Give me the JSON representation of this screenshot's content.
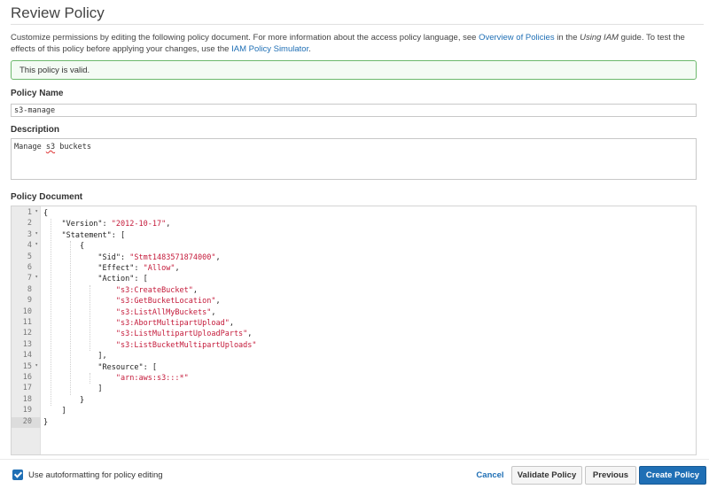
{
  "page": {
    "title": "Review Policy",
    "intro_1": "Customize permissions by editing the following policy document. For more information about the access policy language, see ",
    "intro_link_1": "Overview of Policies",
    "intro_2": " in the ",
    "intro_italic": "Using IAM",
    "intro_3": " guide. To test the effects of this policy before applying your changes, use the ",
    "intro_link_2": "IAM Policy Simulator",
    "intro_4": "."
  },
  "validation": {
    "message": "This policy is valid.",
    "color": "#6cb86c"
  },
  "policy_name": {
    "label": "Policy Name",
    "value": "s3-manage"
  },
  "description": {
    "label": "Description",
    "value_1": "Manage ",
    "value_misspelled": "s3",
    "value_2": " buckets"
  },
  "policy_document": {
    "label": "Policy Document",
    "line_numbers": [
      "1",
      "2",
      "3",
      "4",
      "5",
      "6",
      "7",
      "8",
      "9",
      "10",
      "11",
      "12",
      "13",
      "14",
      "15",
      "16",
      "17",
      "18",
      "19",
      "20"
    ],
    "lines": [
      "{",
      "    \"Version\": \"2012-10-17\",",
      "    \"Statement\": [",
      "        {",
      "            \"Sid\": \"Stmt1483571874000\",",
      "            \"Effect\": \"Allow\",",
      "            \"Action\": [",
      "                \"s3:CreateBucket\",",
      "                \"s3:GetBucketLocation\",",
      "                \"s3:ListAllMyBuckets\",",
      "                \"s3:AbortMultipartUpload\",",
      "                \"s3:ListMultipartUploadParts\",",
      "                \"s3:ListBucketMultipartUploads\"",
      "            ],",
      "            \"Resource\": [",
      "                \"arn:aws:s3:::*\"",
      "            ]",
      "        }",
      "    ]",
      "}"
    ],
    "fold_markers": [
      "1",
      "3",
      "4",
      "7",
      "15"
    ],
    "active_line": "20"
  },
  "footer": {
    "autoformat_label": "Use autoformatting for policy editing",
    "autoformat_checked": true,
    "cancel": "Cancel",
    "validate": "Validate Policy",
    "previous": "Previous",
    "create": "Create Policy"
  },
  "colors": {
    "primary": "#1f6fb5",
    "string": "#c41a3a"
  }
}
